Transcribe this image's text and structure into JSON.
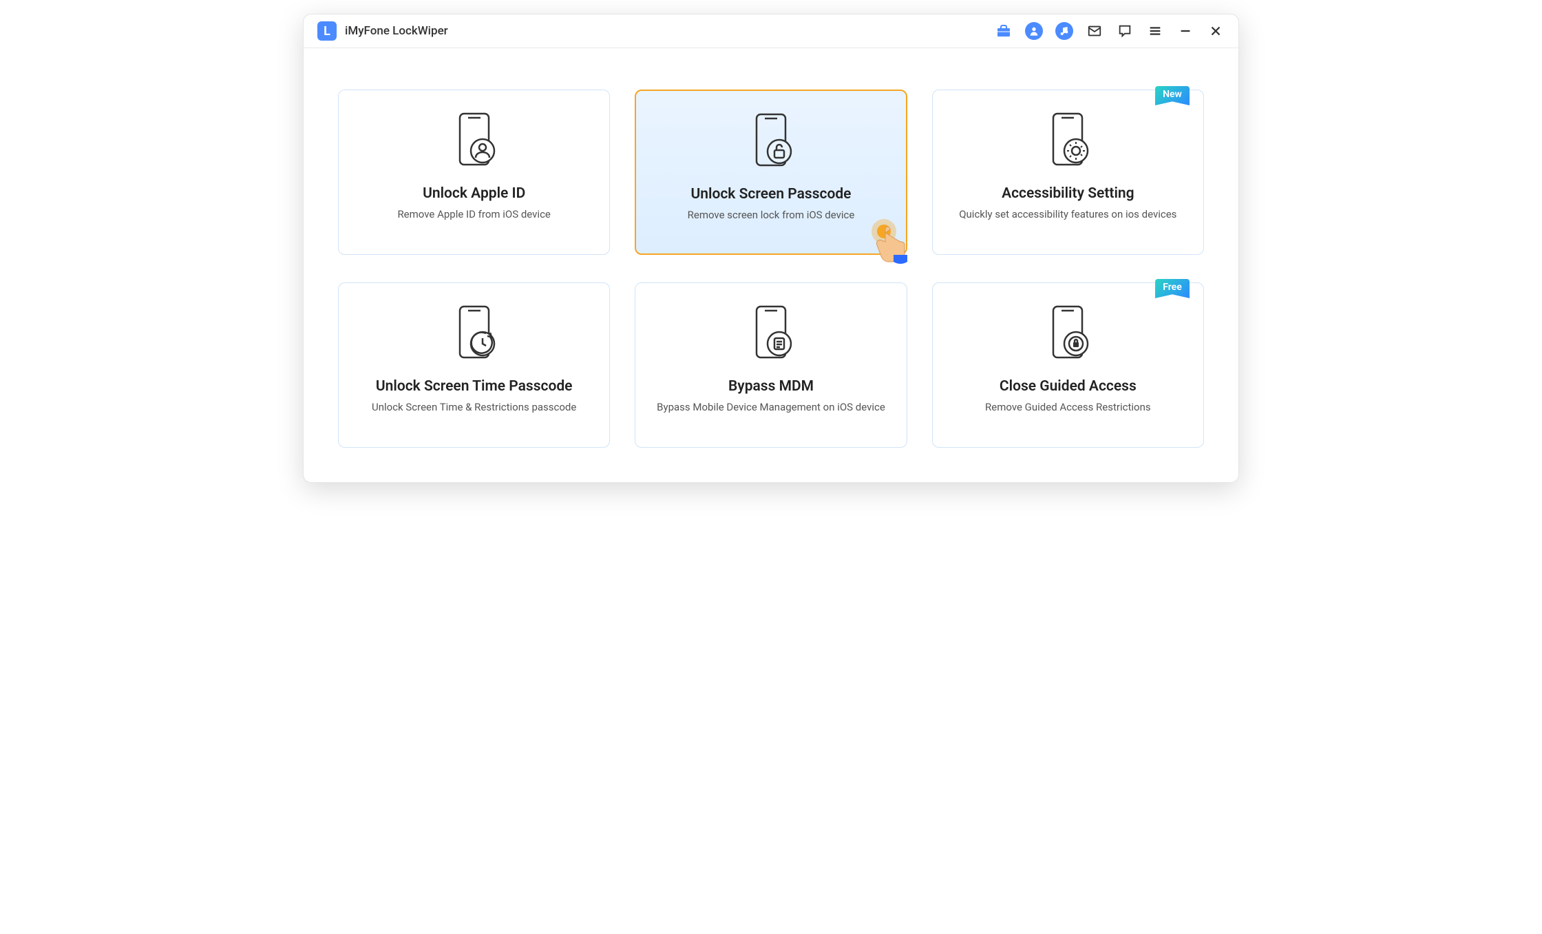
{
  "app": {
    "title": "iMyFone LockWiper",
    "logo_letter": "L"
  },
  "cards": [
    {
      "title": "Unlock Apple ID",
      "desc": "Remove Apple ID from iOS device",
      "icon": "phone-user",
      "selected": false,
      "badge": null
    },
    {
      "title": "Unlock Screen Passcode",
      "desc": "Remove screen lock from iOS device",
      "icon": "phone-lock",
      "selected": true,
      "badge": null
    },
    {
      "title": "Accessibility Setting",
      "desc": "Quickly set accessibility features on ios devices",
      "icon": "phone-gear",
      "selected": false,
      "badge": "New"
    },
    {
      "title": "Unlock Screen Time Passcode",
      "desc": "Unlock Screen Time & Restrictions passcode",
      "icon": "phone-clock",
      "selected": false,
      "badge": null
    },
    {
      "title": "Bypass MDM",
      "desc": "Bypass Mobile Device Management on iOS device",
      "icon": "phone-doc",
      "selected": false,
      "badge": null
    },
    {
      "title": "Close Guided Access",
      "desc": "Remove Guided Access Restrictions",
      "icon": "phone-shield",
      "selected": false,
      "badge": "Free"
    }
  ]
}
